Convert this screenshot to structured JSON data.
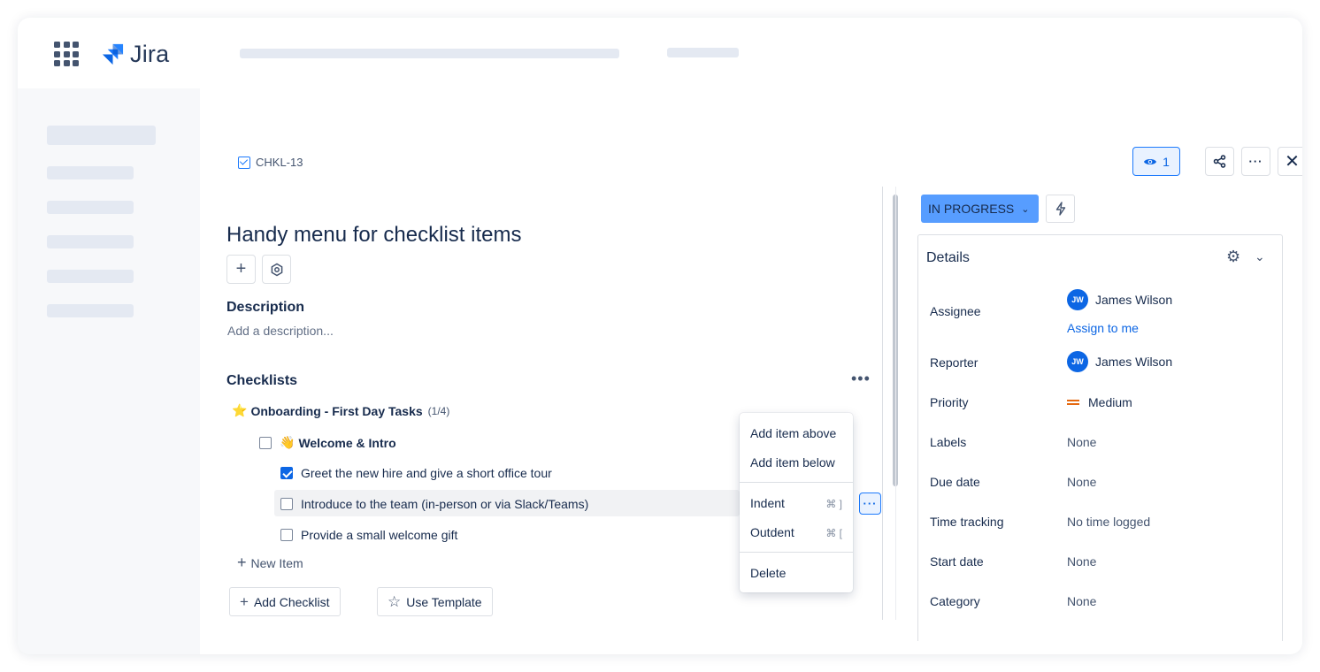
{
  "app": {
    "name": "Jira"
  },
  "issue": {
    "key": "CHKL-13",
    "title": "Handy menu for checklist items"
  },
  "description": {
    "heading": "Description",
    "placeholder": "Add a description..."
  },
  "checklists": {
    "heading": "Checklists",
    "title_emoji": "⭐",
    "title": "Onboarding - First Day Tasks",
    "count": "(1/4)",
    "items": [
      {
        "emoji": "👋",
        "label": "Welcome & Intro",
        "checked": false,
        "group": true
      },
      {
        "label": "Greet the new hire and give a short office tour",
        "checked": true
      },
      {
        "label": "Introduce to the team (in-person or via Slack/Teams)",
        "checked": false
      },
      {
        "label": "Provide a small welcome gift",
        "checked": false
      }
    ],
    "new_item_label": "New Item",
    "add_checklist_label": "Add Checklist",
    "use_template_label": "Use Template"
  },
  "context_menu": {
    "add_above": "Add item above",
    "add_below": "Add item below",
    "indent": "Indent",
    "indent_shortcut": "⌘ ]",
    "outdent": "Outdent",
    "outdent_shortcut": "⌘ [",
    "delete": "Delete"
  },
  "header_actions": {
    "watchers_count": "1"
  },
  "status": {
    "label": "IN PROGRESS",
    "color": "#579dff"
  },
  "details": {
    "heading": "Details",
    "assignee_label": "Assignee",
    "assignee_initials": "JW",
    "assignee_name": "James Wilson",
    "assign_to_me": "Assign to me",
    "reporter_label": "Reporter",
    "reporter_initials": "JW",
    "reporter_name": "James Wilson",
    "priority_label": "Priority",
    "priority_value": "Medium",
    "labels_label": "Labels",
    "labels_value": "None",
    "due_date_label": "Due date",
    "due_date_value": "None",
    "time_tracking_label": "Time tracking",
    "time_tracking_value": "No time logged",
    "start_date_label": "Start date",
    "start_date_value": "None",
    "category_label": "Category",
    "category_value": "None"
  },
  "colors": {
    "accent": "#0c66e4",
    "priority_medium": "#e56910"
  }
}
